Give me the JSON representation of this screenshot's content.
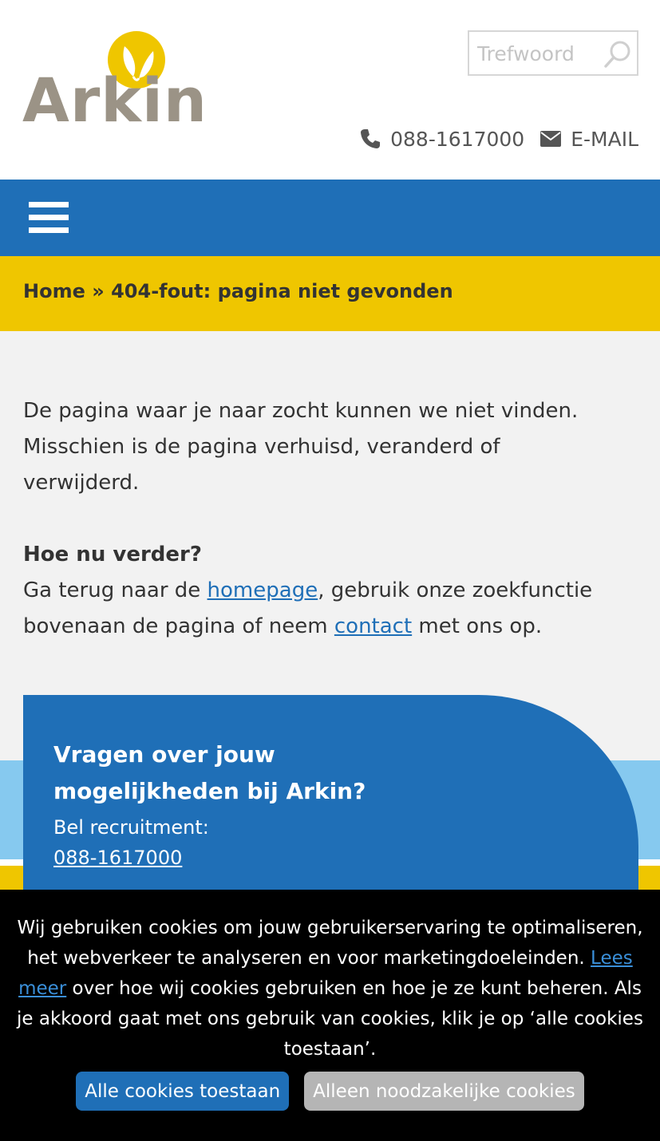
{
  "header": {
    "logo_text": "Arkin",
    "search": {
      "placeholder": "Trefwoord",
      "value": ""
    },
    "search_icon": "search-icon",
    "phone": {
      "icon": "phone-icon",
      "label": "088-1617000"
    },
    "email": {
      "icon": "envelope-icon",
      "label": "E-MAIL"
    }
  },
  "nav": {
    "menu_icon": "hamburger-menu-icon"
  },
  "breadcrumb": {
    "home": "Home",
    "separator": "»",
    "current": "404-fout: pagina niet gevonden"
  },
  "content": {
    "intro": "De pagina waar je naar zocht kunnen we niet vinden. Mis­schien is de pagina verhuisd, veranderd of verwijderd.",
    "heading": "Hoe nu verder?",
    "text_before_link1": "Ga terug naar de ",
    "link_homepage": "homepage",
    "text_between_links": ", gebruik onze zoekfunctie bo­venaan de pagina of neem ",
    "link_contact": "contact",
    "text_after_link2": " met ons op."
  },
  "cta": {
    "title": "Vragen over jouw mogelijkheden bij Arkin?",
    "label": "Bel recruitment:",
    "phone": "088-1617000"
  },
  "cookie": {
    "text_before_link": "Wij gebruiken cookies om jouw gebruikerservaring te optimaliseren, het webverkeer te analyseren en voor marketingdoeleinden. ",
    "link_label": "Lees meer",
    "text_after_link": " over hoe wij cookies gebruiken en hoe je ze kunt beheren. Als je ak­koord gaat met ons gebruik van cookies, klik je op ‘alle cookies toestaan’.",
    "accept_all": "Alle cookies toestaan",
    "only_necessary": "Alleen noodzakelijke cookies"
  },
  "colors": {
    "brand_blue": "#1f6fb7",
    "brand_yellow": "#efc600",
    "light_blue": "#86c9ef",
    "logo_grey": "#9b9386",
    "cookie_bg": "#000000",
    "button_grey": "#b5b5b5"
  }
}
